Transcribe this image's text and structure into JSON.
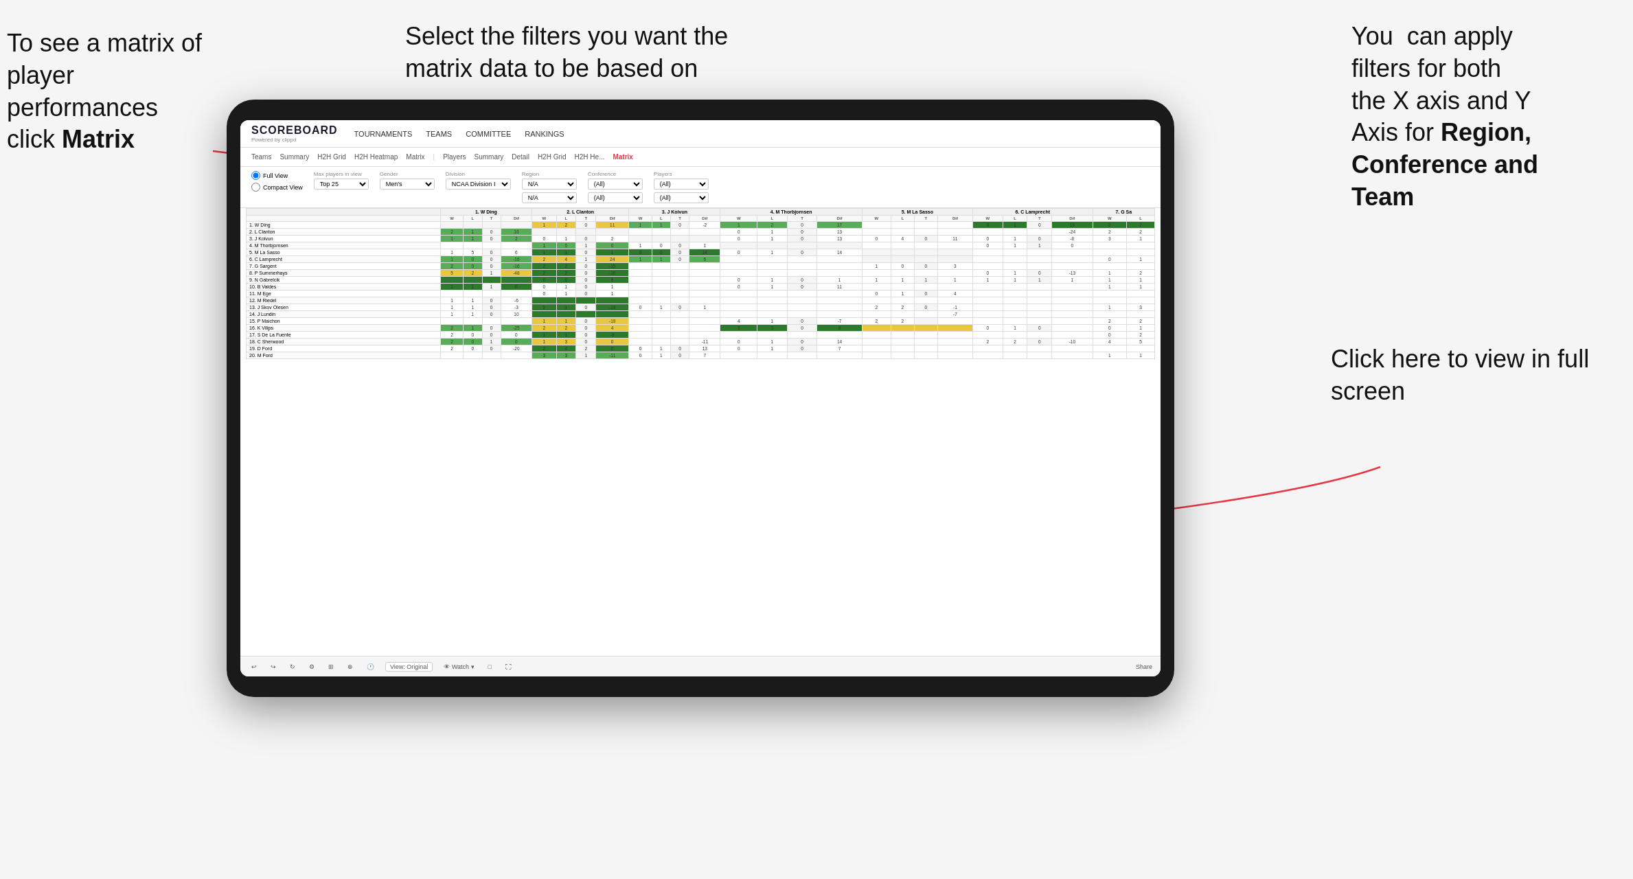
{
  "annotations": {
    "topleft": {
      "line1": "To see a matrix of",
      "line2": "player performances",
      "line3_prefix": "click ",
      "line3_bold": "Matrix"
    },
    "topmiddle": {
      "text": "Select the filters you want the matrix data to be based on"
    },
    "topright": {
      "line1": "You  can apply",
      "line2": "filters for both",
      "line3": "the X axis and Y",
      "line4_prefix": "Axis for ",
      "line4_bold": "Region,",
      "line5_bold": "Conference and",
      "line6_bold": "Team"
    },
    "bottomright": {
      "text": "Click here to view in full screen"
    }
  },
  "app": {
    "logo": "SCOREBOARD",
    "logo_sub": "Powered by clippd",
    "nav_items": [
      "TOURNAMENTS",
      "TEAMS",
      "COMMITTEE",
      "RANKINGS"
    ],
    "sub_nav_items": [
      "Teams",
      "Summary",
      "H2H Grid",
      "H2H Heatmap",
      "Matrix",
      "Players",
      "Summary",
      "Detail",
      "H2H Grid",
      "H2H He...",
      "Matrix"
    ],
    "active_tab": "Matrix"
  },
  "filters": {
    "view_options": [
      "Full View",
      "Compact View"
    ],
    "selected_view": "Full View",
    "max_players_label": "Max players in view",
    "max_players_value": "Top 25",
    "gender_label": "Gender",
    "gender_value": "Men's",
    "division_label": "Division",
    "division_value": "NCAA Division I",
    "region_label": "Region",
    "region_values": [
      "N/A",
      "N/A"
    ],
    "conference_label": "Conference",
    "conference_values": [
      "(All)",
      "(All)"
    ],
    "players_label": "Players",
    "players_values": [
      "(All)",
      "(All)"
    ]
  },
  "matrix": {
    "col_headers": [
      "1. W Ding",
      "2. L Clanton",
      "3. J Koivun",
      "4. M Thorbjornsen",
      "5. M La Sasso",
      "6. C Lamprecht",
      "7. G Sa"
    ],
    "sub_headers": [
      "W",
      "L",
      "T",
      "Dif"
    ],
    "row_players": [
      "1. W Ding",
      "2. L Clanton",
      "3. J Koivun",
      "4. M Thorbjornsen",
      "5. M La Sasso",
      "6. C Lamprecht",
      "7. G Sargent",
      "8. P Summerhays",
      "9. N Gabrelcik",
      "10. B Valdes",
      "11. M Ege",
      "12. M Riedel",
      "13. J Skov Olesen",
      "14. J Lundin",
      "15. P Maichon",
      "16. K Vilips",
      "17. S De La Fuente",
      "18. C Sherwood",
      "19. D Ford",
      "20. M Ford"
    ]
  },
  "toolbar": {
    "view_label": "View: Original",
    "watch_label": "Watch",
    "share_label": "Share"
  }
}
